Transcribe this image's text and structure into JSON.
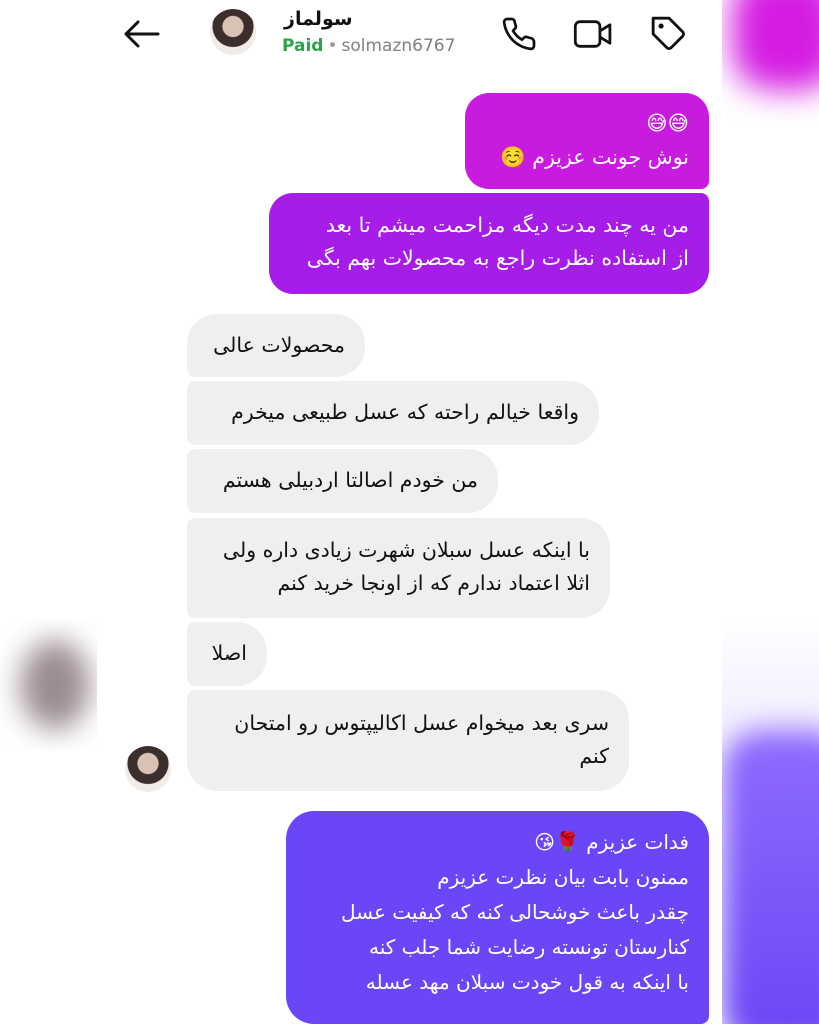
{
  "header": {
    "name": "سولماز",
    "status": "Paid",
    "username": "solmazn6767"
  },
  "messages": {
    "outgoing": [
      {
        "text_line1": "😅😅",
        "text_line2": "نوش جونت عزیزم ☺️"
      },
      {
        "text_line1": "من یه چند مدت دیگه مزاحمت میشم تا بعد",
        "text_line2": "از استفاده نظرت راجع به محصولات بهم بگی"
      }
    ],
    "incoming": [
      {
        "text": "محصولات عالی"
      },
      {
        "text": "واقعا خیالم راحته که عسل طبیعی میخرم"
      },
      {
        "text": "من خودم اصالتا اردبیلی هستم"
      },
      {
        "text_line1": "با اینکه عسل سبلان شهرت زیادی داره ولی",
        "text_line2": "اثلا اعتماد ندارم که از اونجا خرید کنم"
      },
      {
        "text": "اصلا"
      },
      {
        "text_line1": "سری بعد میخوام عسل اکالیپتوس رو امتحان",
        "text_line2": "کنم"
      }
    ],
    "reply": {
      "line1": "فدات عزیزم 🌹😘",
      "line2": "ممنون بابت بیان نظرت عزیزم",
      "line3": "چقدر باعث خوشحالی کنه که کیفیت عسل",
      "line4": "کنارستان تونسته رضایت شما جلب کنه",
      "line5": "با اینکه به قول خودت سبلان مهد عسله"
    }
  },
  "colors": {
    "outgoing_top": "#c91ae0",
    "outgoing_second": "#a51de6",
    "reply": "#6a46f6",
    "incoming_bg": "#efefef",
    "paid": "#2aa34a"
  },
  "icons": {
    "back": "arrow-left-icon",
    "call": "phone-icon",
    "video": "video-camera-icon",
    "label": "tag-icon"
  }
}
